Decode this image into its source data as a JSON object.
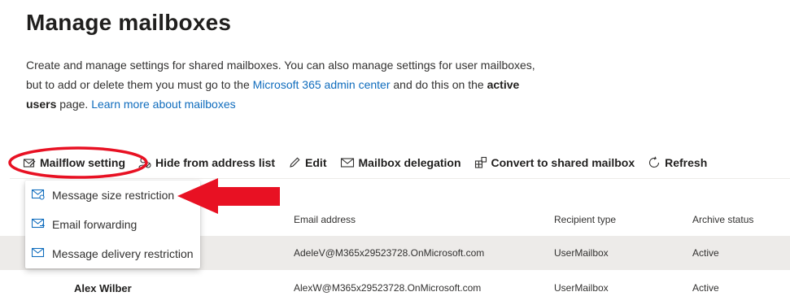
{
  "page": {
    "title": "Manage mailboxes",
    "description": {
      "part1": "Create and manage settings for shared mailboxes. You can also manage settings for user mailboxes, but to add or delete them you must go to the ",
      "admin_link": "Microsoft 365 admin center",
      "part2": " and do this on the ",
      "bold": "active users",
      "part3": " page. ",
      "learn_link": "Learn more about mailboxes"
    }
  },
  "toolbar": {
    "mailflow": "Mailflow setting",
    "hide": "Hide from address list",
    "edit": "Edit",
    "delegation": "Mailbox delegation",
    "convert": "Convert to shared mailbox",
    "refresh": "Refresh"
  },
  "menu": {
    "items": [
      {
        "label": "Message size restriction",
        "icon": "envelope-gear-icon"
      },
      {
        "label": "Email forwarding",
        "icon": "envelope-forward-icon"
      },
      {
        "label": "Message delivery restriction",
        "icon": "envelope-icon"
      }
    ]
  },
  "table": {
    "columns": [
      "Email address",
      "Recipient type",
      "Archive status"
    ],
    "rows": [
      {
        "name": "",
        "email": "AdeleV@M365x29523728.OnMicrosoft.com",
        "type": "UserMailbox",
        "archive": "Active",
        "selected": true
      },
      {
        "name": "Alex Wilber",
        "email": "AlexW@M365x29523728.OnMicrosoft.com",
        "type": "UserMailbox",
        "archive": "Active",
        "selected": false
      }
    ]
  },
  "colors": {
    "link": "#0f6cbd",
    "annotation": "#e81123",
    "row_selected": "#edebe9"
  }
}
